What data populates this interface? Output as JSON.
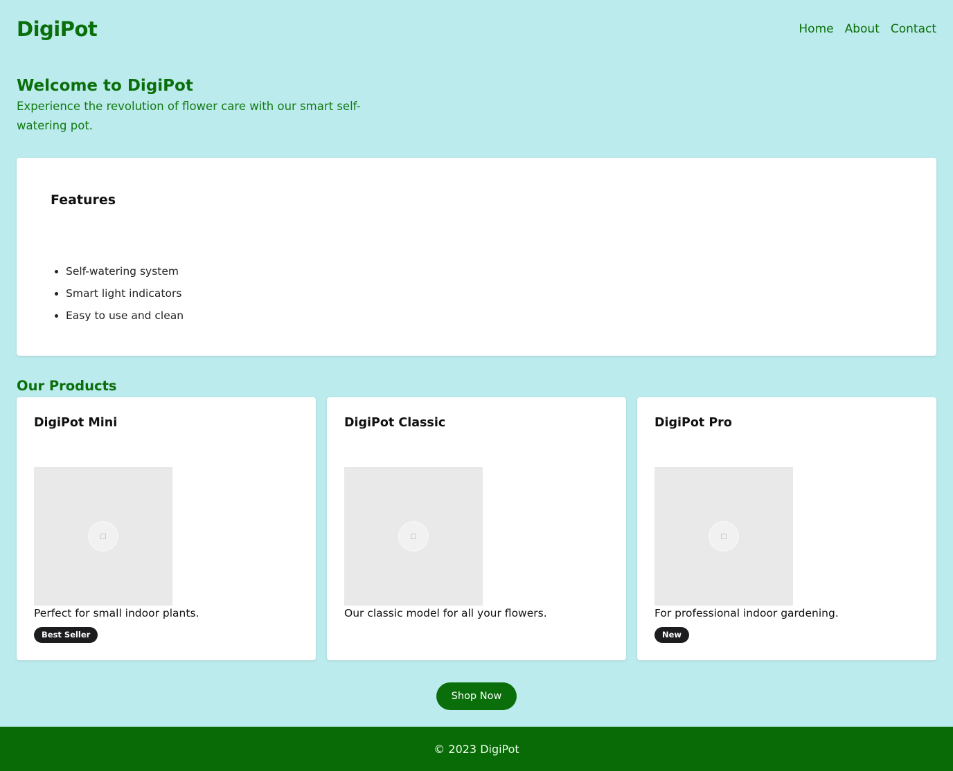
{
  "header": {
    "logo": "DigiPot",
    "nav": [
      {
        "label": "Home"
      },
      {
        "label": "About"
      },
      {
        "label": "Contact"
      }
    ]
  },
  "hero": {
    "title": "Welcome to DigiPot",
    "subtitle": "Experience the revolution of flower care with our smart self-watering pot."
  },
  "features": {
    "title": "Features",
    "items": [
      "Self-watering system",
      "Smart light indicators",
      "Easy to use and clean"
    ]
  },
  "products": {
    "title": "Our Products",
    "items": [
      {
        "name": "DigiPot Mini",
        "description": "Perfect for small indoor plants.",
        "badge": "Best Seller",
        "image_icon": "image-placeholder-icon"
      },
      {
        "name": "DigiPot Classic",
        "description": "Our classic model for all your flowers.",
        "badge": null,
        "image_icon": "image-placeholder-icon"
      },
      {
        "name": "DigiPot Pro",
        "description": "For professional indoor gardening.",
        "badge": "New",
        "image_icon": "image-placeholder-icon"
      }
    ]
  },
  "cta": {
    "label": "Shop Now"
  },
  "footer": {
    "text": "© 2023 DigiPot"
  },
  "colors": {
    "background": "#bcebed",
    "brand_green": "#0a6f0a",
    "footer_green": "#086b05",
    "badge_dark": "#1c1c1f"
  }
}
